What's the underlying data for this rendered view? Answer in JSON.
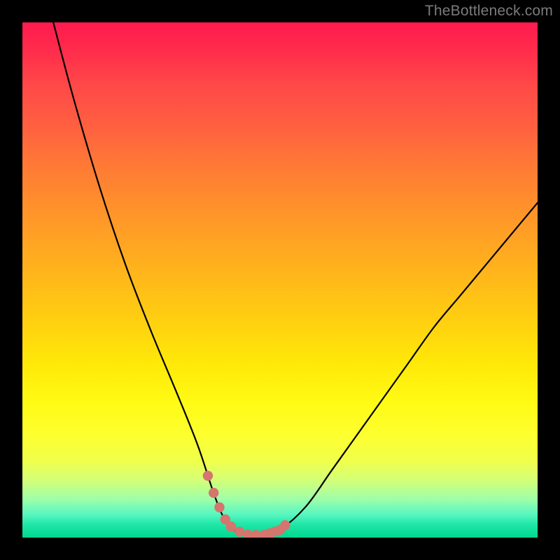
{
  "watermark": "TheBottleneck.com",
  "colors": {
    "curve": "#000000",
    "dotted_segment": "#d6746e",
    "background_frame": "#000000"
  },
  "chart_data": {
    "type": "line",
    "title": "",
    "xlabel": "",
    "ylabel": "",
    "xlim": [
      0,
      100
    ],
    "ylim": [
      0,
      100
    ],
    "grid": false,
    "legend": false,
    "description": "Bottleneck-style V curve over vertical rainbow gradient. Left branch descends steeply from top; curve bottoms out (percent bottleneck ≈ 0) across ~x 38–48, then right branch rises concavely reaching ~y 65 at x=100.",
    "series": [
      {
        "name": "bottleneck-curve",
        "x": [
          6,
          10,
          15,
          20,
          25,
          30,
          34,
          37,
          39,
          41,
          44,
          47,
          50,
          55,
          60,
          65,
          70,
          75,
          80,
          85,
          90,
          95,
          100
        ],
        "values": [
          100,
          85,
          68,
          53,
          40,
          28,
          18,
          9,
          4,
          1.5,
          0.5,
          0.5,
          1.5,
          6,
          13,
          20,
          27,
          34,
          41,
          47,
          53,
          59,
          65
        ]
      }
    ],
    "annotations": {
      "dotted_ranges_x": [
        [
          36,
          40.5
        ],
        [
          47,
          51
        ]
      ],
      "dot_style": "thick pink dotted segments near valley walls"
    },
    "gradient_stops": [
      {
        "pos": 0.0,
        "color": "#ff1a4e"
      },
      {
        "pos": 0.5,
        "color": "#ffc515"
      },
      {
        "pos": 0.78,
        "color": "#fffd20"
      },
      {
        "pos": 1.0,
        "color": "#00d98f"
      }
    ]
  }
}
